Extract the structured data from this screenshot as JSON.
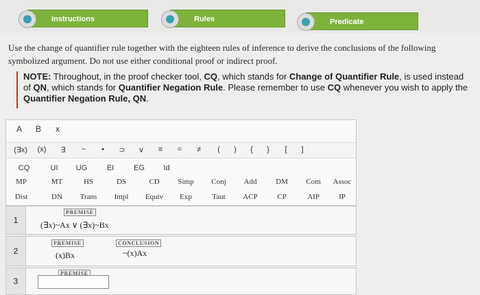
{
  "tabs": [
    {
      "label": "Instructions"
    },
    {
      "label": "Rules"
    },
    {
      "label": "Predicate"
    }
  ],
  "instructions": "Use the change of quantifier rule together with the eighteen rules of inference to derive the conclusions of the following symbolized argument. Do not use either conditional proof or indirect proof.",
  "note": {
    "prefix": "NOTE:",
    "t1": " Throughout, in the proof checker tool, ",
    "cq": "CQ",
    "t2": ", which stands for ",
    "cqname": "Change of Quantifier Rule",
    "t3": ", is used instead of ",
    "qn": "QN",
    "t4": ", which stands for ",
    "qnname": "Quantifier Negation Rule",
    "t5": ". Please remember to use ",
    "cq2": "CQ",
    "t6": " whenever you wish to apply the ",
    "qnname2": "Quantifier Negation Rule, QN",
    "t7": "."
  },
  "toolbox": {
    "vars": [
      "A",
      "B",
      "x"
    ],
    "symbols": [
      "(∃x)",
      "(x)",
      "∃",
      "~",
      "•",
      "⊃",
      "∨",
      "≡",
      "=",
      "≠",
      "(",
      ")",
      "{",
      "}",
      "[",
      "]"
    ],
    "rules_row1": [
      "CQ",
      "UI",
      "UG",
      "EI",
      "EG",
      "Id"
    ],
    "rules_row2": [
      "MP",
      "MT",
      "HS",
      "DS",
      "CD",
      "Simp",
      "Conj",
      "Add",
      "DM",
      "Com",
      "Assoc"
    ],
    "rules_row3": [
      "Dist",
      "DN",
      "Trans",
      "Impl",
      "Equiv",
      "Exp",
      "Taut",
      "ACP",
      "CP",
      "AIP",
      "IP"
    ]
  },
  "proof": {
    "lines": [
      {
        "num": "1",
        "tag": "PREMISE",
        "statement": "(∃x)~Ax ∨ (∃x)~Bx"
      },
      {
        "num": "2",
        "tag": "PREMISE",
        "statement": "(x)Bx",
        "tag2": "CONCLUSION",
        "statement2": "~(x)Ax"
      },
      {
        "num": "3",
        "tag": "PREMISE",
        "statement": ""
      }
    ]
  },
  "colors": {
    "tab_green": "#7fb23a",
    "note_border": "#c0392b"
  }
}
